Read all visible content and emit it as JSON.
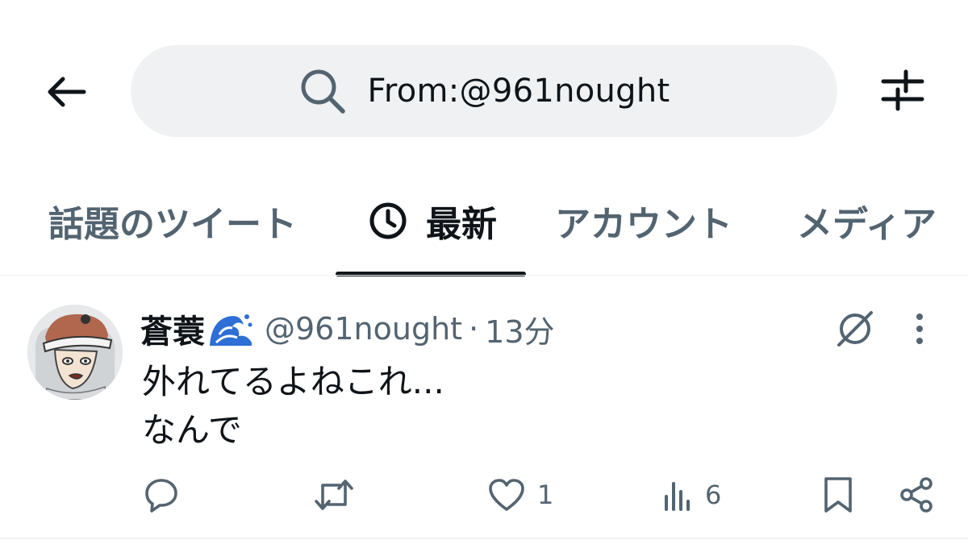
{
  "header": {
    "back_icon": "arrow-left-icon",
    "search": {
      "value": "From:@961nought",
      "icon": "search-icon"
    },
    "filter_icon": "sliders-icon"
  },
  "tabs": [
    {
      "label": "話題のツイート",
      "active": false
    },
    {
      "label": "最新",
      "active": true,
      "icon": "clock-icon"
    },
    {
      "label": "アカウント",
      "active": false
    },
    {
      "label": "メディア",
      "active": false
    }
  ],
  "tweet": {
    "display_name": "蒼蓑",
    "name_emoji": "wave-emoji-icon",
    "handle": "@961nought",
    "separator": "·",
    "time": "13分",
    "text_lines": [
      "外れてるよねこれ...",
      "なんで"
    ],
    "actions": {
      "reply": {
        "icon": "reply-icon",
        "count": ""
      },
      "retweet": {
        "icon": "retweet-icon",
        "count": ""
      },
      "like": {
        "icon": "heart-icon",
        "count": "1"
      },
      "views": {
        "icon": "bar-chart-icon",
        "count": "6"
      },
      "bookmark": {
        "icon": "bookmark-icon"
      },
      "share": {
        "icon": "share-icon"
      }
    }
  },
  "colors": {
    "text_primary": "#0f1419",
    "text_secondary": "#536471",
    "search_bg": "#eff1f2",
    "divider": "#eff3f4"
  }
}
